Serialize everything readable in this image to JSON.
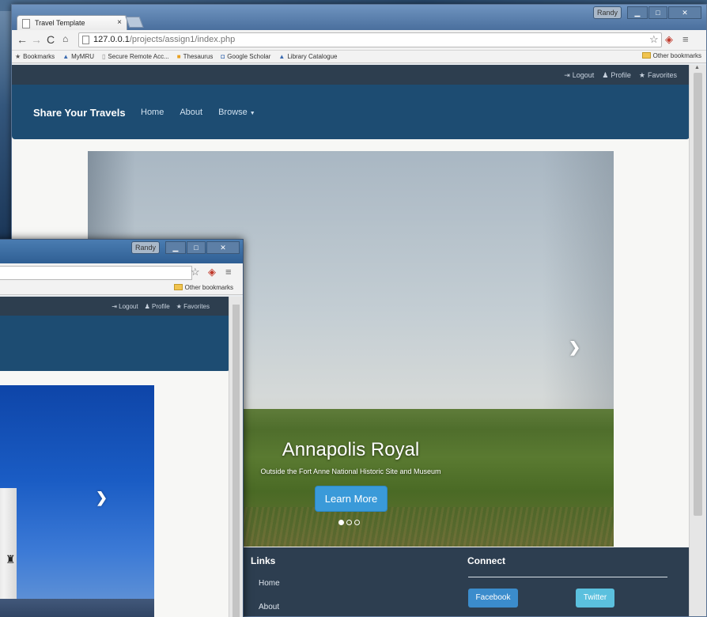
{
  "browser": {
    "tab_title": "Travel Template",
    "tab_close": "×",
    "user_badge": "Randy",
    "url_host": "127.0.0.1",
    "url_path": "/projects/assign1/index.php"
  },
  "bookmarks": {
    "items": [
      "Bookmarks",
      "MyMRU",
      "Secure Remote Acc...",
      "Thesaurus",
      "Google Scholar",
      "Library Catalogue"
    ],
    "other": "Other bookmarks"
  },
  "site": {
    "top_links": {
      "logout": "Logout",
      "profile": "Profile",
      "favorites": "Favorites"
    },
    "brand": "Share Your Travels",
    "nav": {
      "home": "Home",
      "about": "About",
      "browse": "Browse"
    }
  },
  "carousel": {
    "title": "Annapolis Royal",
    "subtitle": "Outside the Fort Anne National Historic Site and Museum",
    "button": "Learn More",
    "slides": 3,
    "active_slide": 1
  },
  "footer": {
    "links_heading": "Links",
    "links": [
      "Home",
      "About"
    ],
    "connect_heading": "Connect",
    "facebook": "Facebook",
    "twitter": "Twitter"
  },
  "back_window": {
    "user_badge": "Randy",
    "other_bookmarks": "Other bookmarks",
    "top_links": {
      "logout": "Logout",
      "profile": "Profile",
      "favorites": "Favorites"
    }
  }
}
